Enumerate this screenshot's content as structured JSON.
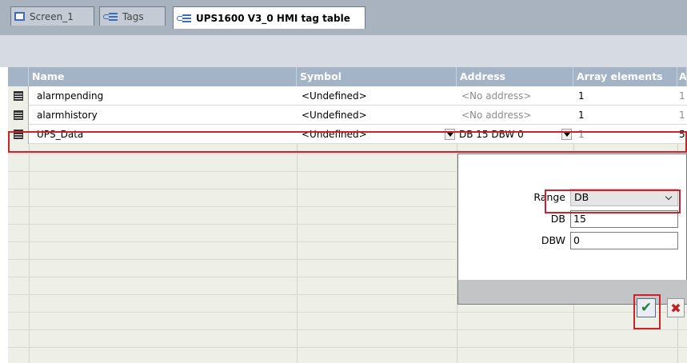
{
  "tabs": [
    {
      "label": "Screen_1",
      "icon": "screen-icon",
      "active": false
    },
    {
      "label": "Tags",
      "icon": "tags-icon",
      "active": false
    },
    {
      "label": "UPS1600 V3_0 HMI tag table",
      "icon": "tag-table-icon",
      "active": true
    }
  ],
  "table": {
    "columns": [
      "Name",
      "Symbol",
      "Address",
      "Array elements",
      "A"
    ],
    "rows": [
      {
        "name": "alarmpending",
        "symbol": "<Undefined>",
        "address": "<No address>",
        "array_elements": "1",
        "extra": "1"
      },
      {
        "name": "alarmhistory",
        "symbol": "<Undefined>",
        "address": "<No address>",
        "array_elements": "1",
        "extra": "1"
      },
      {
        "name": "UPS_Data",
        "symbol": "<Undefined>",
        "address": "DB 15 DBW 0",
        "array_elements": "1",
        "extra": "5"
      }
    ]
  },
  "address_popup": {
    "range_label": "Range",
    "range_value": "DB",
    "db_label": "DB",
    "db_value": "15",
    "dbw_label": "DBW",
    "dbw_value": "0",
    "ok_icon": "checkmark-icon",
    "cancel_icon": "cross-icon"
  },
  "colors": {
    "header_bg": "#a3b4c6",
    "highlight_red": "#d0202a",
    "tabstrip_bg": "#a9b2bf"
  }
}
